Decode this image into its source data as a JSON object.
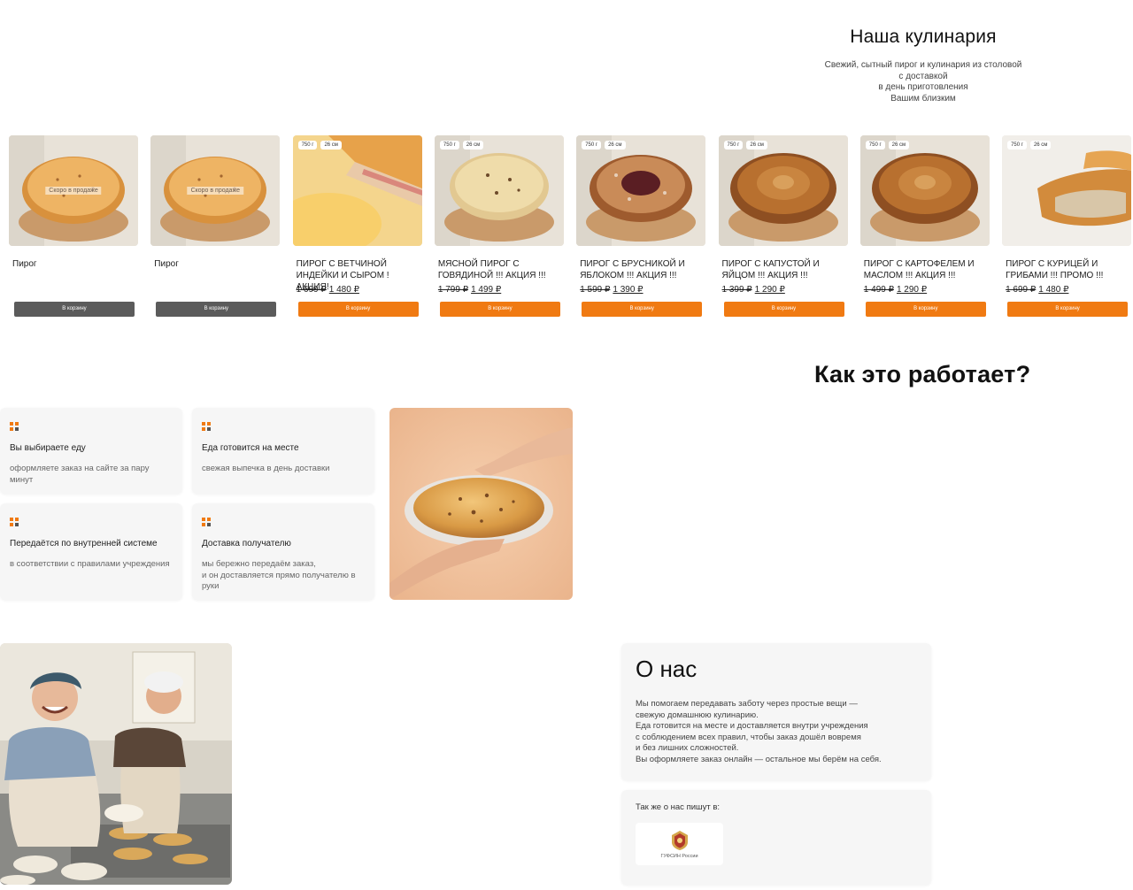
{
  "catalog": {
    "title": "Наша кулинария",
    "subtitle_lines": [
      "Свежий, сытный пирог и кулинария из столовой",
      "с доставкой",
      "в день приготовления",
      "Вашим близким"
    ]
  },
  "products": [
    {
      "name": "Пирог",
      "caps": false,
      "soon": "Скоро в продаже",
      "weight": "",
      "size": "",
      "old_price": "",
      "price": "",
      "button": "В корзину",
      "button_color": "#5b5b5b"
    },
    {
      "name": "Пирог",
      "caps": false,
      "soon": "Скоро в продаже",
      "weight": "",
      "size": "",
      "old_price": "",
      "price": "",
      "button": "В корзину",
      "button_color": "#5b5b5b"
    },
    {
      "name": "Пирог с ветчиной индейки и сыром !акция!",
      "caps": true,
      "soon": "",
      "weight": "750 г",
      "size": "26 см",
      "old_price": "1 699 ₽",
      "price": "1 480 ₽",
      "button": "В корзину",
      "button_color": "#f07a12"
    },
    {
      "name": "Мясной пирог с говядиной !!! акция !!!",
      "caps": true,
      "soon": "",
      "weight": "750 г",
      "size": "26 см",
      "old_price": "1 799 ₽",
      "price": "1 499 ₽",
      "button": "В корзину",
      "button_color": "#f07a12"
    },
    {
      "name": "Пирог с брусникой и яблоком !!! акция !!!",
      "caps": true,
      "soon": "",
      "weight": "750 г",
      "size": "26 см",
      "old_price": "1 599 ₽",
      "price": "1 390 ₽",
      "button": "В корзину",
      "button_color": "#f07a12"
    },
    {
      "name": "Пирог с капустой и яйцом !!! акция !!!",
      "caps": true,
      "soon": "",
      "weight": "750 г",
      "size": "26 см",
      "old_price": "1 399 ₽",
      "price": "1 290 ₽",
      "button": "В корзину",
      "button_color": "#f07a12"
    },
    {
      "name": "Пирог с картофелем и маслом !!! акция !!!",
      "caps": true,
      "soon": "",
      "weight": "750 г",
      "size": "26 см",
      "old_price": "1 499 ₽",
      "price": "1 290 ₽",
      "button": "В корзину",
      "button_color": "#f07a12"
    },
    {
      "name": "Пирог с курицей и грибами !!! промо !!!",
      "caps": true,
      "soon": "",
      "weight": "750 г",
      "size": "26 см",
      "old_price": "1 699 ₽",
      "price": "1 480 ₽",
      "button": "В корзину",
      "button_color": "#f07a12"
    }
  ],
  "how": {
    "title": "Как это работает?",
    "steps": [
      {
        "title": "Вы выбираете еду",
        "text": "оформляете заказ на сайте за пару минут"
      },
      {
        "title": "Еда готовится на месте",
        "text": "свежая выпечка в день доставки"
      },
      {
        "title": "Передаётся по внутренней системе",
        "text": "в соответствии с правилами учреждения"
      },
      {
        "title": "Доставка получателю",
        "text": "мы бережно передаём заказ,\nи он доставляется прямо получателю в руки"
      }
    ],
    "icon_colors": [
      "#f07a12",
      "#555555"
    ]
  },
  "about": {
    "title": "О нас",
    "text": "Мы помогаем передавать заботу через простые вещи —\nсвежую домашнюю кулинарию.\nЕда готовится на месте и доставляется внутри учреждения\nс соблюдением всех правил, чтобы заказ дошёл вовремя\nи без лишних сложностей.\nВы оформляете заказ онлайн — остальное мы берём на себя.",
    "press_title": "Так же о нас пишут в:",
    "press_logo": "ГУФСИН России"
  },
  "colors": {
    "accent": "#f07a12",
    "disabled": "#5b5b5b",
    "card_bg": "#f6f6f6"
  }
}
